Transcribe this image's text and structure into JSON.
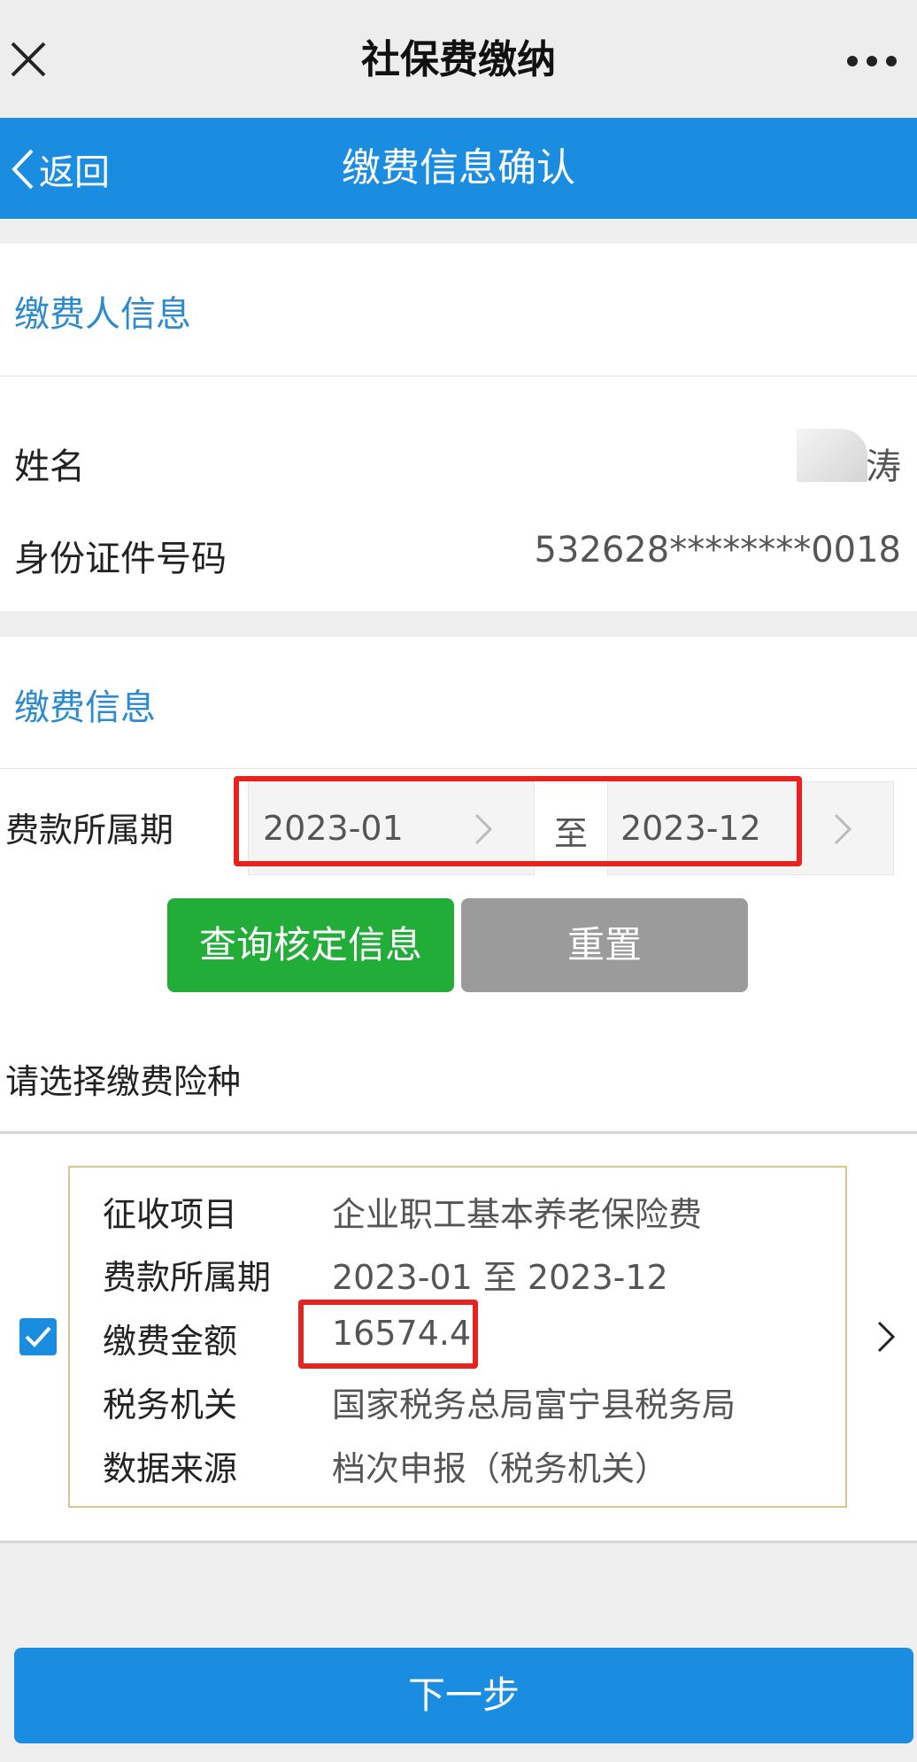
{
  "app_header": {
    "title": "社保费缴纳"
  },
  "nav": {
    "back_label": "返回",
    "title": "缴费信息确认"
  },
  "payer_section": {
    "heading": "缴费人信息",
    "name_label": "姓名",
    "name_value": "涛",
    "id_label": "身份证件号码",
    "id_value": "532628********0018"
  },
  "payment_section": {
    "heading": "缴费信息",
    "period_label": "费款所属期",
    "period_start": "2023-01",
    "period_to": "至",
    "period_end": "2023-12",
    "query_button": "查询核定信息",
    "reset_button": "重置",
    "choose_label": "请选择缴费险种"
  },
  "insurance_item": {
    "checked": true,
    "rows": [
      {
        "label": "征收项目",
        "value": "企业职工基本养老保险费"
      },
      {
        "label": "费款所属期",
        "value": "2023-01 至 2023-12"
      },
      {
        "label": "缴费金额",
        "value": "16574.4"
      },
      {
        "label": "税务机关",
        "value": "国家税务总局富宁县税务局"
      },
      {
        "label": "数据来源",
        "value": "档次申报（税务机关）"
      }
    ]
  },
  "footer": {
    "next_button": "下一步"
  },
  "colors": {
    "primary": "#1a8de1",
    "query_green": "#22ad38",
    "reset_gray": "#9b9b9b",
    "highlight_red": "#e8231f",
    "section_blue": "#2b8ad0"
  }
}
